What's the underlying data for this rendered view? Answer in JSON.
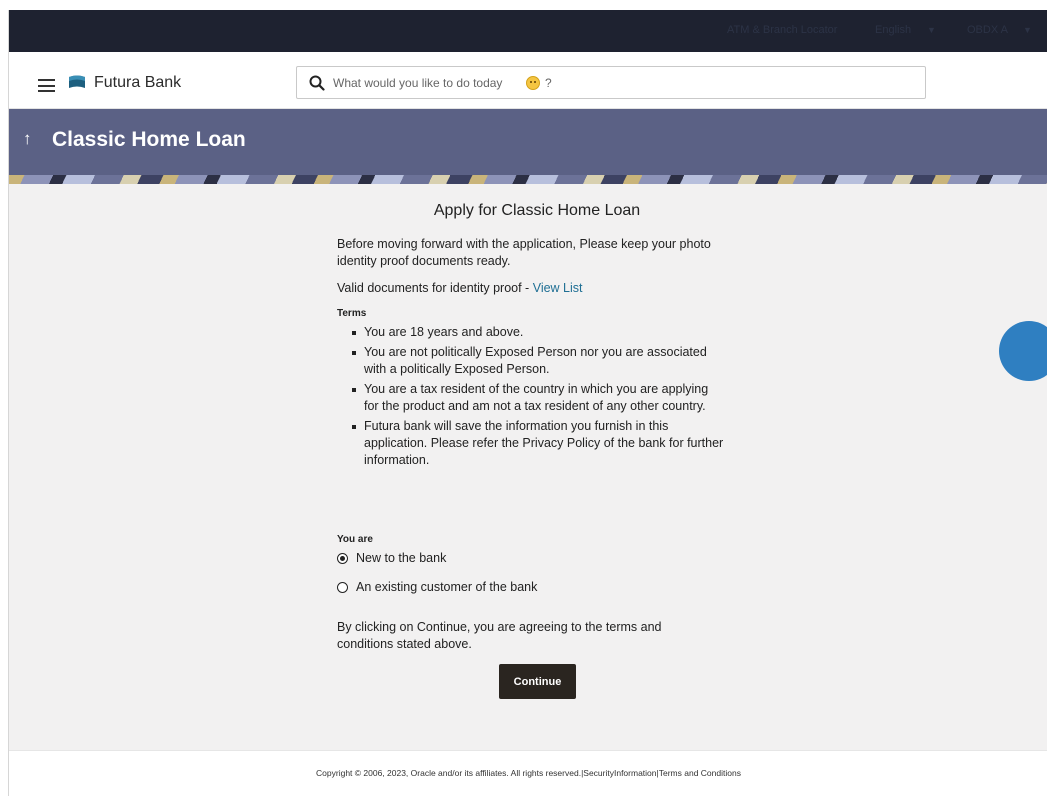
{
  "topbar": {
    "atm_locator": "ATM & Branch Locator",
    "language": "English",
    "user": "OBDX A"
  },
  "header": {
    "brand": "Futura Bank",
    "search_placeholder": "What would you like to do today",
    "search_suffix": "?"
  },
  "banner": {
    "title": "Classic Home Loan"
  },
  "main": {
    "heading": "Apply for Classic Home Loan",
    "intro": "Before moving forward with the application, Please keep your photo identity proof documents ready.",
    "valid_docs_label": "Valid documents for identity proof - ",
    "view_list_link": "View List",
    "terms_label": "Terms",
    "terms": [
      "You are 18 years and above.",
      "You are not politically Exposed Person nor you are associated with a politically Exposed Person.",
      "You are a tax resident of the country in which you are applying for the product and am not a tax resident of any other country.",
      "Futura bank will save the information you furnish in this application. Please refer the Privacy Policy of the bank for further information."
    ],
    "you_are_label": "You are",
    "options": [
      {
        "label": "New to the bank",
        "selected": true
      },
      {
        "label": "An existing customer of the bank",
        "selected": false
      }
    ],
    "agree_text": "By clicking on Continue, you are agreeing to the terms and conditions stated above.",
    "continue_label": "Continue"
  },
  "footer": {
    "copyright": "Copyright © 2006, 2023, Oracle and/or its affiliates. All rights reserved.",
    "security_info": "SecurityInformation",
    "terms": "Terms and Conditions"
  },
  "colors": {
    "banner": "#5b6185",
    "topbar": "#1e2230",
    "link": "#1f6f94",
    "button": "#2a2520"
  }
}
